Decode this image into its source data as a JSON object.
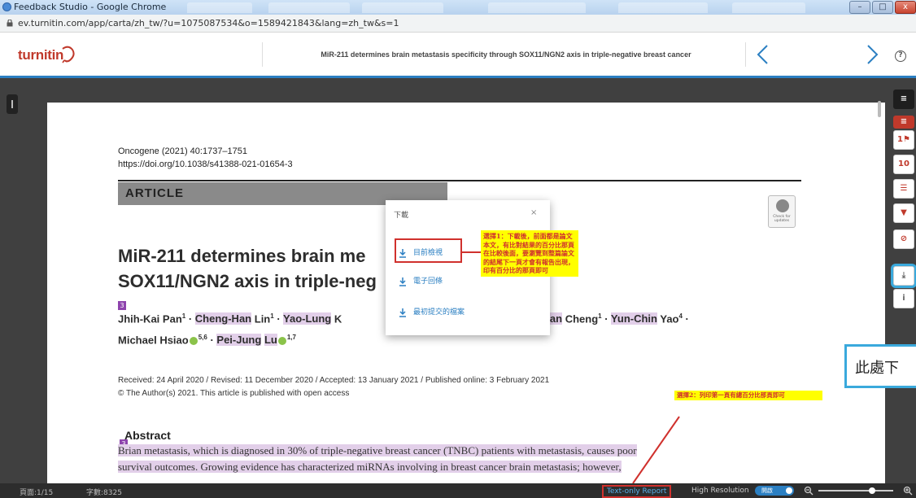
{
  "browser": {
    "window_title": "Feedback Studio - Google Chrome",
    "url": "ev.turnitin.com/app/carta/zh_tw/?u=1075087534&o=1589421843&lang=zh_tw&s=1"
  },
  "header": {
    "logo": "turnitin",
    "paper_title": "MiR-211 determines brain metastasis specificity through SOX11/NGN2 axis in triple-negative breast cancer",
    "help": "?"
  },
  "document": {
    "citation": "Oncogene (2021) 40:1737–1751",
    "doi": "https://doi.org/10.1038/s41388-021-01654-3",
    "section": "ARTICLE",
    "crossmark": "Check for updates",
    "title_line1": "MiR-211 determines brain me",
    "title_line2": "SOX11/NGN2 axis in triple-neg",
    "match_number": "3",
    "authors": {
      "a1": "Jhih-Kai",
      "a1b": "Pan",
      "a1sup": "1",
      "sep1": " · ",
      "a2": "Cheng-Han",
      "a2b": "Lin",
      "a2sup": "1",
      "sep2": " · ",
      "a3": "Yao-Lung",
      "a3b": "K",
      "b1": "huan",
      "b1b": "Cheng",
      "b1sup": "1",
      "sep3": " · ",
      "b2": "Yun-Chin",
      "b2b": "Yao",
      "b2sup": "4",
      "sep4": " ·",
      "c1": "Michael",
      "c1b": "Hsiao",
      "c1sup": "5,6",
      "sep5": " · ",
      "c2": "Pei-Jung",
      "c2b": "Lu",
      "c2sup": "1,7"
    },
    "received": "Received: 24 April 2020 / Revised: 11 December 2020 / Accepted: 13 January 2021 / Published online: 3 February 2021",
    "copyright": "© The Author(s) 2021. This article is published with open access",
    "abstract_heading": "Abstract",
    "abstract_line1": "Brian metastasis, which is diagnosed in 30% of triple-negative breast cancer (TNBC) patients with metastasis, causes poor",
    "abstract_line2": "survival outcomes. Growing evidence has characterized miRNAs involving in breast cancer brain metastasis; however,"
  },
  "download_dialog": {
    "title": "下載",
    "close": "×",
    "items": [
      "目前檢視",
      "電子回條",
      "最初提交的檔案"
    ]
  },
  "annotations": {
    "note1": "選擇1：下載後，前面都是論文本文，有比對結果的百分比那頁在比較後面，要瀏覽到整篇論文的結尾下一頁才會有報告出現，印有百分比的那頁即可",
    "note2": "選擇2：列印第一頁有總百分比那頁即可",
    "note3": "此處下"
  },
  "sidebar": {
    "layers": "≡",
    "match_count": "1",
    "item_10": "10",
    "filter": "▼",
    "block": "⊘",
    "download": "⤓",
    "info": "i"
  },
  "status": {
    "page": "頁面:1/15",
    "words": "字數:8325",
    "text_only": "Text-only Report",
    "high_res": "High Resolution",
    "toggle": "開啟"
  },
  "colors": {
    "turnitin_red": "#c0392b",
    "header_blue_line": "#2b7fc2",
    "callout_yellow": "#ffff00",
    "callout_red_text": "#d0312d",
    "highlight_purple": "#e2cfe9",
    "focus_blue": "#3aa9dc"
  }
}
